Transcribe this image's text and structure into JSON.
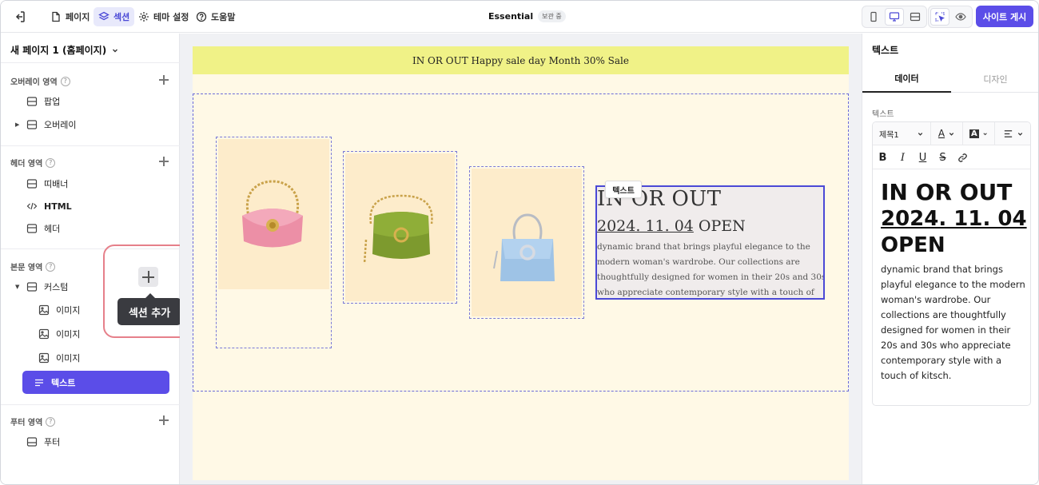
{
  "topbar": {
    "tabs": [
      {
        "label": "페이지",
        "icon": "document-icon"
      },
      {
        "label": "섹션",
        "icon": "layers-icon"
      },
      {
        "label": "테마 설정",
        "icon": "gear-icon"
      },
      {
        "label": "도움말",
        "icon": "help-icon"
      }
    ],
    "active_tab": "섹션",
    "site_title": "Essential",
    "save_status": "보관 중",
    "devices": [
      "mobile-icon",
      "desktop-icon",
      "fullwidth-icon"
    ],
    "active_device": "desktop-icon",
    "tools": [
      "select-cursor-icon",
      "eye-icon"
    ],
    "publish_label": "사이트 게시"
  },
  "sidebar": {
    "page_name": "새 페이지 1 (홈페이지)",
    "sections": [
      {
        "title": "오버레이 영역",
        "items": [
          {
            "label": "팝업",
            "icon": "section-icon"
          },
          {
            "label": "오버레이",
            "icon": "section-icon"
          }
        ]
      },
      {
        "title": "헤더 영역",
        "items": [
          {
            "label": "띠배너",
            "icon": "section-icon"
          },
          {
            "label": "HTML",
            "icon": "code-icon"
          },
          {
            "label": "헤더",
            "icon": "section-icon"
          }
        ]
      },
      {
        "title": "본문 영역",
        "items": [
          {
            "label": "커스텀",
            "icon": "section-icon"
          },
          {
            "label": "이미지",
            "icon": "image-icon"
          },
          {
            "label": "이미지",
            "icon": "image-icon"
          },
          {
            "label": "이미지",
            "icon": "image-icon"
          },
          {
            "label": "텍스트",
            "icon": "text-lines-icon"
          }
        ]
      },
      {
        "title": "푸터 영역",
        "items": [
          {
            "label": "푸터",
            "icon": "section-icon"
          }
        ]
      }
    ],
    "selected_item": "텍스트",
    "tooltip": "섹션 추가"
  },
  "canvas": {
    "banner_text": "IN OR OUT Happy sale day Month 30% Sale",
    "text_tag": "텍스트",
    "headline": "IN OR OUT",
    "date_text": "2024. 11. 04",
    "open_text": "OPEN",
    "body": "dynamic brand that brings playful elegance to the modern woman's wardrobe. Our collections are thoughtfully designed for women in their 20s and 30s who appreciate contemporary style with a touch of kitsch.",
    "products": [
      "pink bag",
      "green bag",
      "blue bag"
    ],
    "colors": {
      "page_bg": "#fff9e6",
      "banner_bg": "#f0f287",
      "accent": "#5b4de8"
    }
  },
  "panel": {
    "title": "텍스트",
    "tabs": [
      "데이터",
      "디자인"
    ],
    "active_tab": "데이터",
    "field_label": "텍스트",
    "heading_select": "제목1",
    "editor_h1": "IN OR OUT",
    "editor_date": "2024. 11. 04",
    "editor_open": "OPEN",
    "editor_body": "dynamic brand that brings playful elegance to the modern woman's wardrobe. Our collections are thoughtfully designed for women in their 20s and 30s who appreciate contemporary style with a touch of kitsch."
  }
}
